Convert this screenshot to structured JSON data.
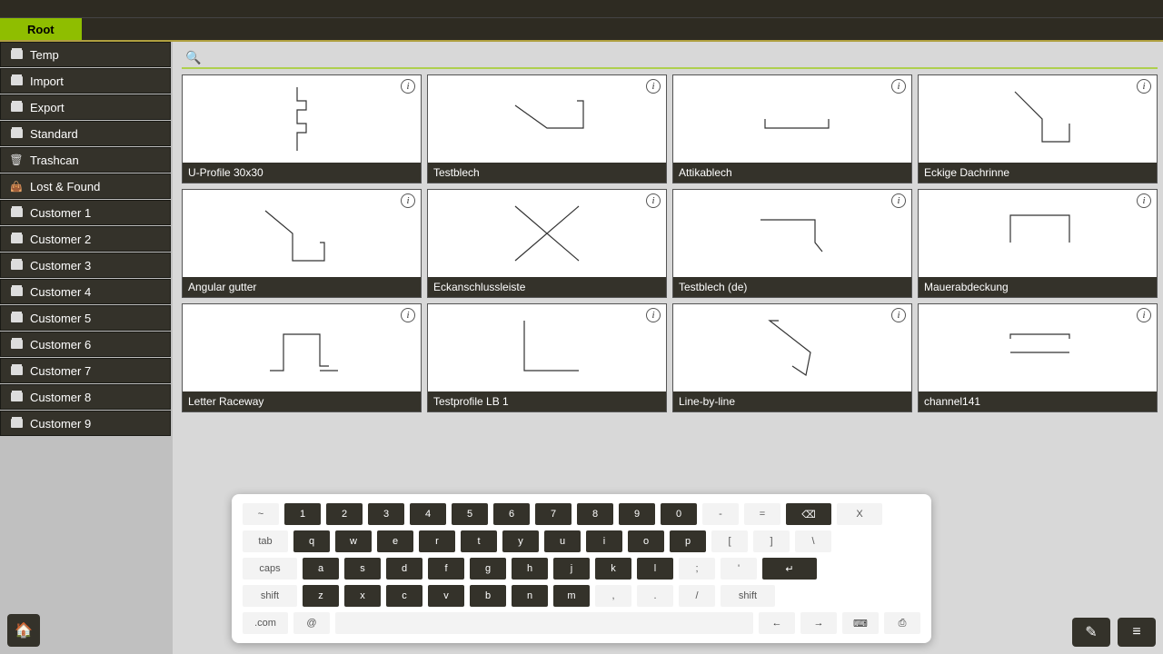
{
  "tab": {
    "label": "Root"
  },
  "sidebar": {
    "items": [
      {
        "label": "Temp",
        "icon": "folder"
      },
      {
        "label": "Import",
        "icon": "folder"
      },
      {
        "label": "Export",
        "icon": "folder"
      },
      {
        "label": "Standard",
        "icon": "folder"
      },
      {
        "label": "Trashcan",
        "icon": "trash"
      },
      {
        "label": "Lost & Found",
        "icon": "found"
      },
      {
        "label": "Customer 1",
        "icon": "folder"
      },
      {
        "label": "Customer 2",
        "icon": "folder"
      },
      {
        "label": "Customer 3",
        "icon": "folder"
      },
      {
        "label": "Customer 4",
        "icon": "folder"
      },
      {
        "label": "Customer 5",
        "icon": "folder"
      },
      {
        "label": "Customer 6",
        "icon": "folder"
      },
      {
        "label": "Customer 7",
        "icon": "folder"
      },
      {
        "label": "Customer 8",
        "icon": "folder"
      },
      {
        "label": "Customer 9",
        "icon": "folder"
      }
    ]
  },
  "search": {
    "placeholder": ""
  },
  "cards": [
    {
      "label": "U-Profile 30x30",
      "shape": "uprofile"
    },
    {
      "label": "Testblech",
      "shape": "test1"
    },
    {
      "label": "Attikablech",
      "shape": "attika"
    },
    {
      "label": "Eckige Dachrinne",
      "shape": "gutter1"
    },
    {
      "label": "Angular gutter",
      "shape": "gutter2"
    },
    {
      "label": "Eckanschlussleiste",
      "shape": "cross"
    },
    {
      "label": "Testblech (de)",
      "shape": "test2"
    },
    {
      "label": "Mauerabdeckung",
      "shape": "wallcap"
    },
    {
      "label": "Letter Raceway",
      "shape": "raceway"
    },
    {
      "label": "Testprofile LB 1",
      "shape": "lb1"
    },
    {
      "label": "Line-by-line",
      "shape": "lineby"
    },
    {
      "label": "channel141",
      "shape": "channel"
    }
  ],
  "keyboard": {
    "row1_special_left": "~",
    "row1": [
      "1",
      "2",
      "3",
      "4",
      "5",
      "6",
      "7",
      "8",
      "9",
      "0"
    ],
    "row1_special": [
      "-",
      "="
    ],
    "row1_back": "⌫",
    "row1_close": "X",
    "row2_tab": "tab",
    "row2": [
      "q",
      "w",
      "e",
      "r",
      "t",
      "y",
      "u",
      "i",
      "o",
      "p"
    ],
    "row2_special": [
      "[",
      "]",
      "\\"
    ],
    "row3_caps": "caps",
    "row3": [
      "a",
      "s",
      "d",
      "f",
      "g",
      "h",
      "j",
      "k",
      "l"
    ],
    "row3_special": [
      ";",
      "'"
    ],
    "row3_enter": "↵",
    "row4_shift": "shift",
    "row4": [
      "z",
      "x",
      "c",
      "v",
      "b",
      "n",
      "m"
    ],
    "row4_special": [
      ",",
      ".",
      "/"
    ],
    "row4_shift2": "shift",
    "row5_com": ".com",
    "row5_at": "@",
    "row5_arrows": [
      "←",
      "→"
    ],
    "row5_extra": [
      "⌨",
      "⎙"
    ]
  }
}
